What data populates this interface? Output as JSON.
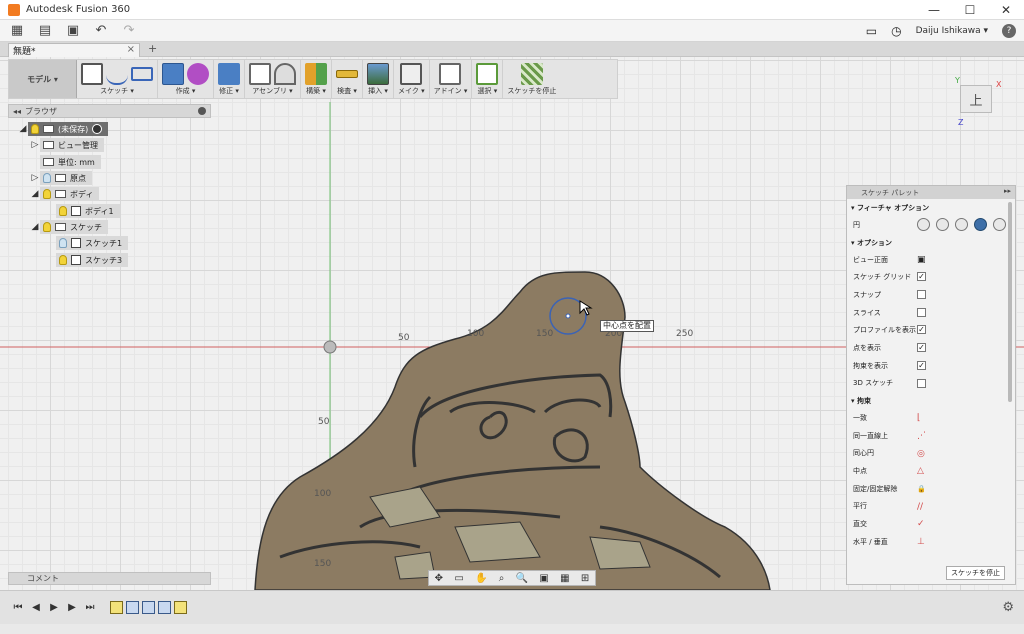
{
  "window": {
    "title": "Autodesk Fusion 360",
    "controls": [
      "—",
      "☐",
      "✕"
    ]
  },
  "appbar": {
    "user": "Daiju Ishikawa ▾",
    "help": "?"
  },
  "tab": {
    "name": "無題*",
    "close": "×",
    "new": "+"
  },
  "toolbar": {
    "mode": "モデル ▾",
    "groups": [
      {
        "label": "スケッチ ▾"
      },
      {
        "label": "作成 ▾"
      },
      {
        "label": "修正 ▾"
      },
      {
        "label": "アセンブリ ▾"
      },
      {
        "label": "構築 ▾"
      },
      {
        "label": "検査 ▾"
      },
      {
        "label": "挿入 ▾"
      },
      {
        "label": "メイク ▾"
      },
      {
        "label": "アドイン ▾"
      },
      {
        "label": "選択 ▾"
      },
      {
        "label": "スケッチを停止"
      }
    ]
  },
  "browser": {
    "title": "ブラウザ",
    "nodes": [
      {
        "label": "(未保存)"
      },
      {
        "label": "ビュー管理"
      },
      {
        "label": "単位: mm"
      },
      {
        "label": "原点"
      },
      {
        "label": "ボディ"
      },
      {
        "label": "ボディ1"
      },
      {
        "label": "スケッチ"
      },
      {
        "label": "スケッチ1"
      },
      {
        "label": "スケッチ3"
      }
    ]
  },
  "comment": {
    "label": "コメント"
  },
  "viewport": {
    "ticks": [
      "50",
      "100",
      "150",
      "200",
      "250",
      "50",
      "100",
      "150"
    ],
    "tooltip": "中心点を配置",
    "viewcube": "上",
    "axes": {
      "x": "X",
      "y": "Y",
      "z": "Z"
    }
  },
  "palette": {
    "title": "スケッチ パレット",
    "feature_section": "▾ フィーチャ オプション",
    "circle_label": "円",
    "options_section": "▾ オプション",
    "options": [
      {
        "label": "ビュー正面",
        "checked": ""
      },
      {
        "label": "スケッチ グリッド",
        "checked": "✓"
      },
      {
        "label": "スナップ",
        "checked": ""
      },
      {
        "label": "スライス",
        "checked": ""
      },
      {
        "label": "プロファイルを表示",
        "checked": "✓"
      },
      {
        "label": "点を表示",
        "checked": "✓"
      },
      {
        "label": "拘束を表示",
        "checked": "✓"
      },
      {
        "label": "3D スケッチ",
        "checked": ""
      }
    ],
    "constraints_section": "▾ 拘束",
    "constraints": [
      {
        "label": "一致",
        "icon": "⌊"
      },
      {
        "label": "同一直線上",
        "icon": "⋰"
      },
      {
        "label": "同心円",
        "icon": "◎"
      },
      {
        "label": "中点",
        "icon": "△"
      },
      {
        "label": "固定/固定解除",
        "icon": "🔒"
      },
      {
        "label": "平行",
        "icon": "//"
      },
      {
        "label": "直交",
        "icon": "✓"
      },
      {
        "label": "水平 / 垂直",
        "icon": "⊥"
      }
    ],
    "stop_button": "スケッチを停止"
  }
}
